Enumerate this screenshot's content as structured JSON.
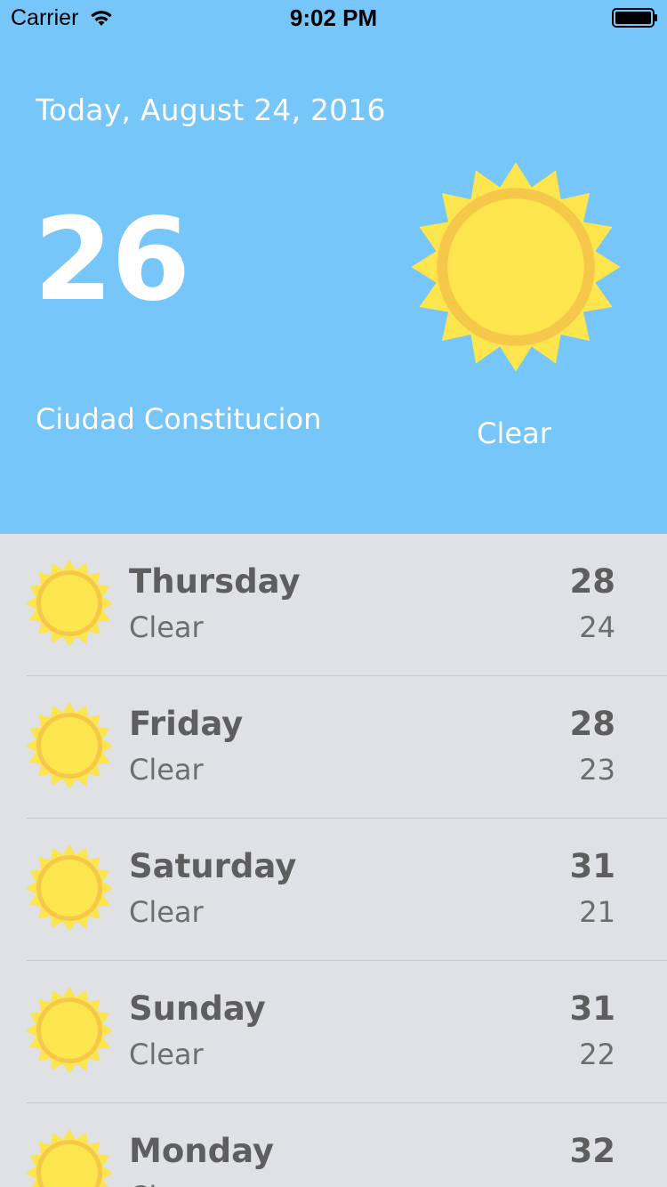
{
  "status_bar": {
    "carrier": "Carrier",
    "time": "9:02 PM"
  },
  "today": {
    "date": "Today, August 24, 2016",
    "temperature": "26",
    "city": "Ciudad Constitucion",
    "condition": "Clear",
    "icon": "sun-icon"
  },
  "forecast": [
    {
      "day": "Thursday",
      "condition": "Clear",
      "high": "28",
      "low": "24",
      "icon": "sun-icon"
    },
    {
      "day": "Friday",
      "condition": "Clear",
      "high": "28",
      "low": "23",
      "icon": "sun-icon"
    },
    {
      "day": "Saturday",
      "condition": "Clear",
      "high": "31",
      "low": "21",
      "icon": "sun-icon"
    },
    {
      "day": "Sunday",
      "condition": "Clear",
      "high": "31",
      "low": "22",
      "icon": "sun-icon"
    },
    {
      "day": "Monday",
      "condition": "Clear",
      "high": "32",
      "low": "",
      "icon": "sun-icon"
    }
  ],
  "colors": {
    "header_background": "#76c6f9",
    "list_background": "#dfe1e4",
    "sun_core": "#fce54d",
    "sun_rays": "#f6c84a"
  }
}
